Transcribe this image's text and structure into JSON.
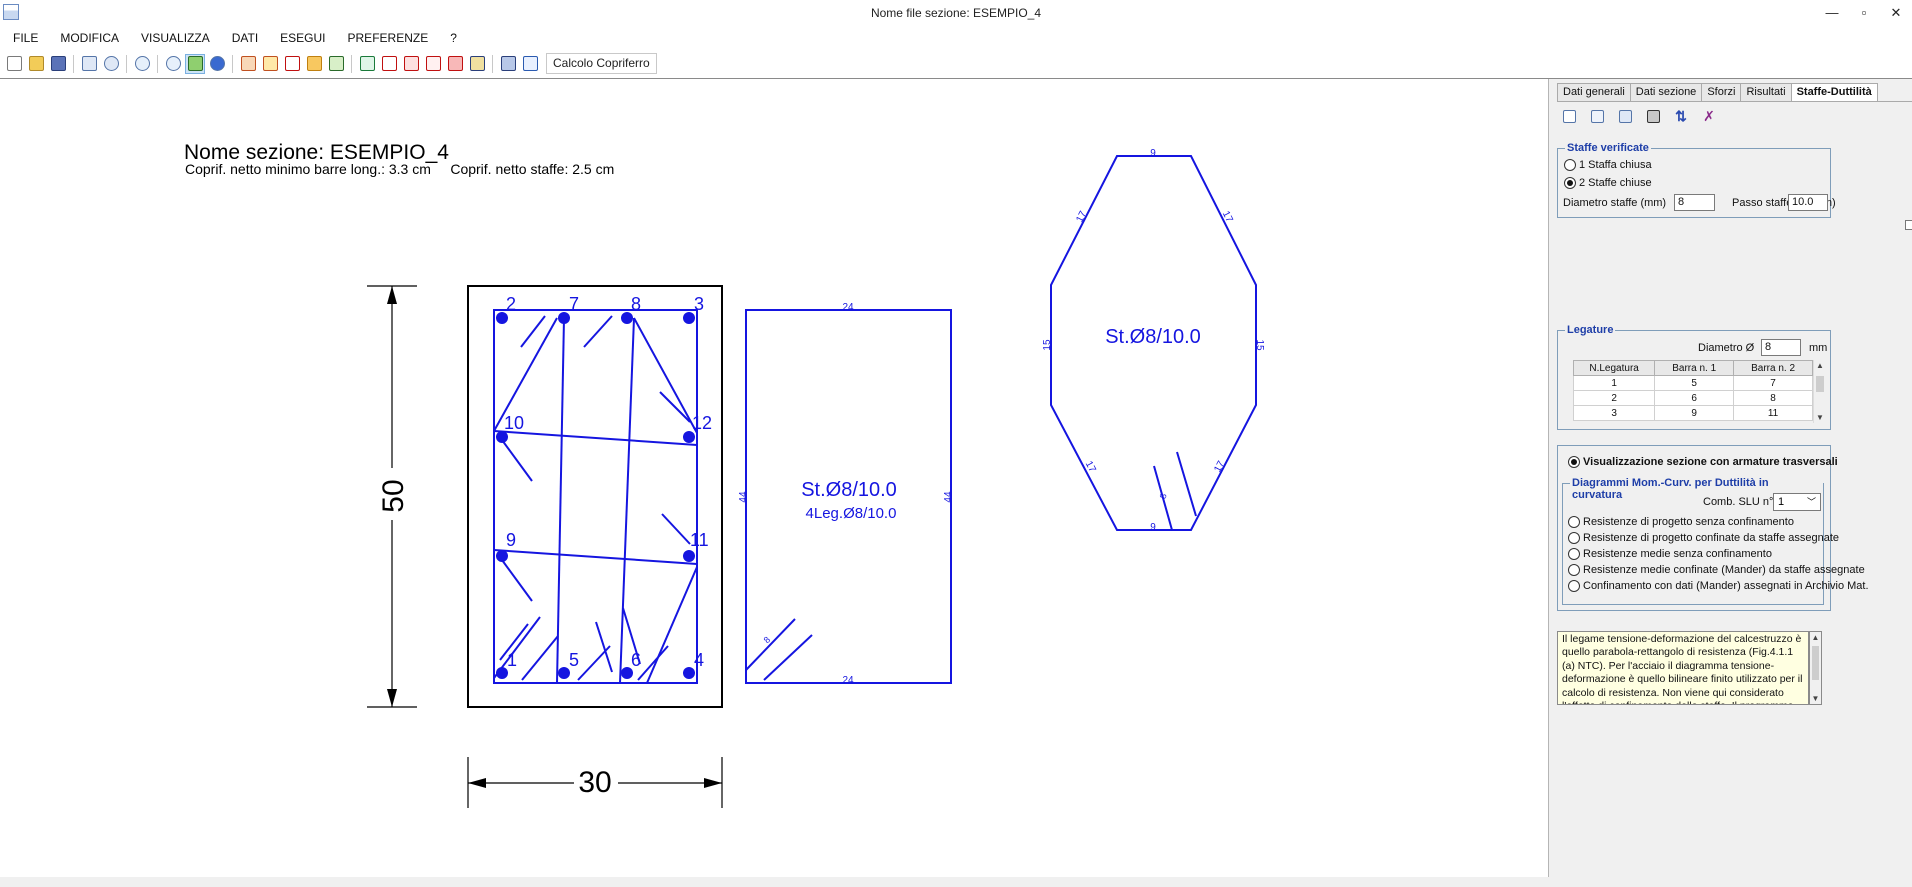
{
  "window": {
    "title": "Nome file sezione: ESEMPIO_4",
    "controls": [
      "—",
      "▫",
      "✕"
    ]
  },
  "menu": [
    "FILE",
    "MODIFICA",
    "VISUALIZZA",
    "DATI",
    "ESEGUI",
    "PREFERENZE",
    "?"
  ],
  "toolbar": {
    "copriferro_label": "Calcolo Copriferro"
  },
  "drawing": {
    "section_name": "Nome sezione: ESEMPIO_4",
    "cover_info": "Coprif. netto minimo barre long.: 3.3 cm     Coprif. netto staffe: 2.5 cm",
    "height_dim": "50",
    "width_dim": "30",
    "bar_numbers": [
      "1",
      "2",
      "3",
      "4",
      "5",
      "6",
      "7",
      "8",
      "9",
      "10",
      "11",
      "12"
    ],
    "stirrup_label": "St.Ø8/10.0",
    "legs_label": "4Leg.Ø8/10.0",
    "rect_dims": {
      "top": "24",
      "bottom": "24",
      "left": "44",
      "right": "44",
      "hook": "8"
    },
    "oct_label": "St.Ø8/10.0",
    "oct_dims": {
      "top": "9",
      "bottom": "9",
      "upper_left": "17",
      "upper_right": "17",
      "left": "15",
      "right": "15",
      "lower_left": "17",
      "lower_right": "17",
      "hook": "8"
    },
    "colors": {
      "drawing": "#1515e0",
      "outline": "#000000"
    }
  },
  "panel": {
    "tabs": [
      "Dati generali",
      "Dati sezione",
      "Sforzi",
      "Risultati",
      "Staffe-Duttilità"
    ],
    "active_tab": "Staffe-Duttilità",
    "staffe_verificate": {
      "title": "Staffe verificate",
      "options": [
        "1 Staffa chiusa",
        "2 Staffe chiuse"
      ],
      "selected": "2 Staffe chiuse",
      "diametro_label": "Diametro staffe (mm)",
      "diametro_value": "8",
      "passo_label": "Passo staffe-leg.(cm)",
      "passo_value": "10.0"
    },
    "legature": {
      "title": "Legature",
      "diametro_label": "Diametro  Ø",
      "diametro_value": "8",
      "unit": "mm",
      "columns": [
        "N.Legatura",
        "Barra n. 1",
        "Barra n. 2"
      ],
      "rows": [
        [
          "1",
          "5",
          "7"
        ],
        [
          "2",
          "6",
          "8"
        ],
        [
          "3",
          "9",
          "11"
        ]
      ]
    },
    "visualizzazione": {
      "main_option": "Visualizzazione sezione con armature trasversali",
      "diagrammi_title": "Diagrammi  Mom.-Curv. per Duttilità in curvatura",
      "comb_label": "Comb. SLU  n°",
      "comb_value": "1",
      "options": [
        "Resistenze di progetto senza confinamento",
        "Resistenze di progetto confinate da staffe assegnate",
        "Resistenze medie senza confinamento",
        "Resistenze medie confinate (Mander)  da staffe assegnate",
        "Confinamento con dati (Mander) assegnati in Archivio Mat."
      ]
    },
    "info_text": "Il legame tensione-deformazione del calcestruzzo è quello parabola-rettangolo di resistenza (Fig.4.1.1 (a) NTC). Per l'acciaio il diagramma tensione-deformazione è quello bilineare finito utilizzato per il calcolo di resistenza. Non viene qui considerato l'effetto di confinamento delle staffe. Il programma calcola la capacità in duttilità in curvatura μ da confrontare con"
  }
}
